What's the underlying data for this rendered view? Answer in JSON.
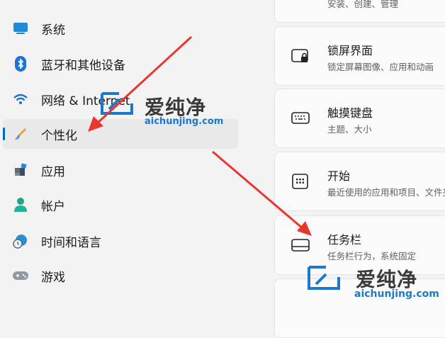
{
  "sidebar": {
    "items": [
      {
        "label": "系统",
        "icon": "monitor-icon"
      },
      {
        "label": "蓝牙和其他设备",
        "icon": "bluetooth-icon"
      },
      {
        "label": "网络 & Internet",
        "icon": "wifi-icon"
      },
      {
        "label": "个性化",
        "icon": "brush-icon",
        "selected": true
      },
      {
        "label": "应用",
        "icon": "apps-icon"
      },
      {
        "label": "帐户",
        "icon": "person-icon"
      },
      {
        "label": "时间和语言",
        "icon": "clock-globe-icon"
      },
      {
        "label": "游戏",
        "icon": "gamepad-icon"
      }
    ]
  },
  "main": {
    "cards": [
      {
        "title": "",
        "desc": "安装、创建、管理",
        "icon": "none"
      },
      {
        "title": "锁屏界面",
        "desc": "锁定屏幕图像、应用和动画",
        "icon": "lock-screen-icon"
      },
      {
        "title": "触摸键盘",
        "desc": "主题、大小",
        "icon": "keyboard-icon"
      },
      {
        "title": "开始",
        "desc": "最近使用的应用和项目、文件夹",
        "icon": "start-grid-icon"
      },
      {
        "title": "任务栏",
        "desc": "任务栏行为，系统固定",
        "icon": "taskbar-icon"
      }
    ]
  },
  "watermark": {
    "cn": "爱纯净",
    "en": "aichunjing.com"
  },
  "colors": {
    "accent": "#0067c0",
    "arrow": "#e8372e",
    "watermark_blue": "#1e78c8"
  }
}
